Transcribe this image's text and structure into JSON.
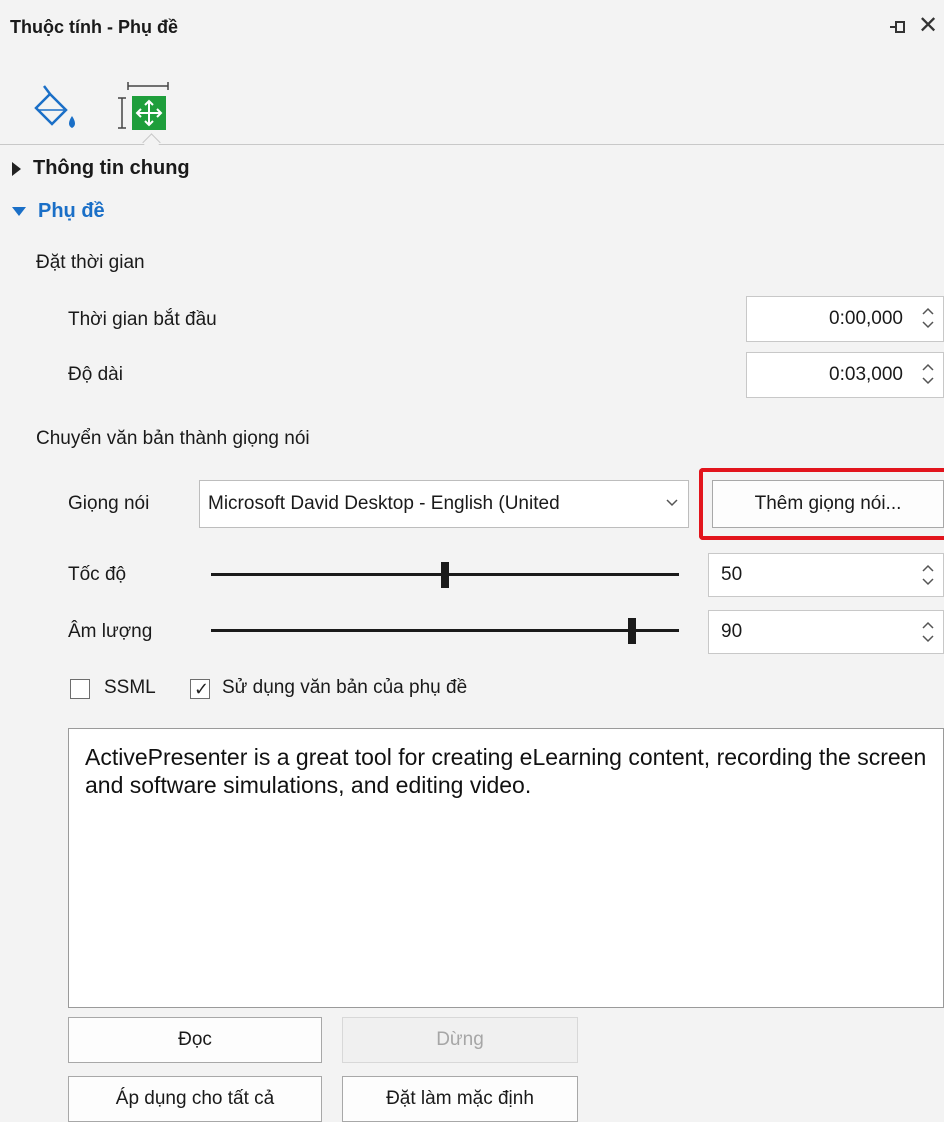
{
  "panel": {
    "title": "Thuộc tính - Phụ đề"
  },
  "toolbar": {
    "tabs": [
      {
        "icon": "paint-bucket-icon"
      },
      {
        "icon": "size-position-icon",
        "active": true
      }
    ]
  },
  "sections": {
    "general": "Thông tin chung",
    "subtitle": "Phụ đề"
  },
  "timing": {
    "heading": "Đặt thời gian",
    "start_label": "Thời gian bắt đầu",
    "start_value": "0:00,000",
    "duration_label": "Độ dài",
    "duration_value": "0:03,000"
  },
  "tts": {
    "heading": "Chuyển văn bản thành giọng nói",
    "voice_label": "Giọng nói",
    "voice_value": "Microsoft David Desktop - English (United",
    "add_voice_label": "Thêm giọng nói...",
    "speed_label": "Tốc độ",
    "speed_value": "50",
    "speed_level": 0.5,
    "volume_label": "Âm lượng",
    "volume_value": "90",
    "volume_level": 0.9,
    "ssml_label": "SSML",
    "ssml_checked": false,
    "use_subtitle_label": "Sử dụng văn bản của phụ đề",
    "use_subtitle_checked": true,
    "text": "ActivePresenter is a great tool for creating eLearning content, recording the screen and software simulations, and editing video."
  },
  "buttons": {
    "read": "Đọc",
    "stop": "Dừng",
    "apply_all": "Áp dụng cho tất cả",
    "set_default": "Đặt làm mặc định"
  },
  "colors": {
    "accent": "#1a6fc7",
    "highlight": "#e2141c",
    "tab_green": "#1e9e3b"
  }
}
